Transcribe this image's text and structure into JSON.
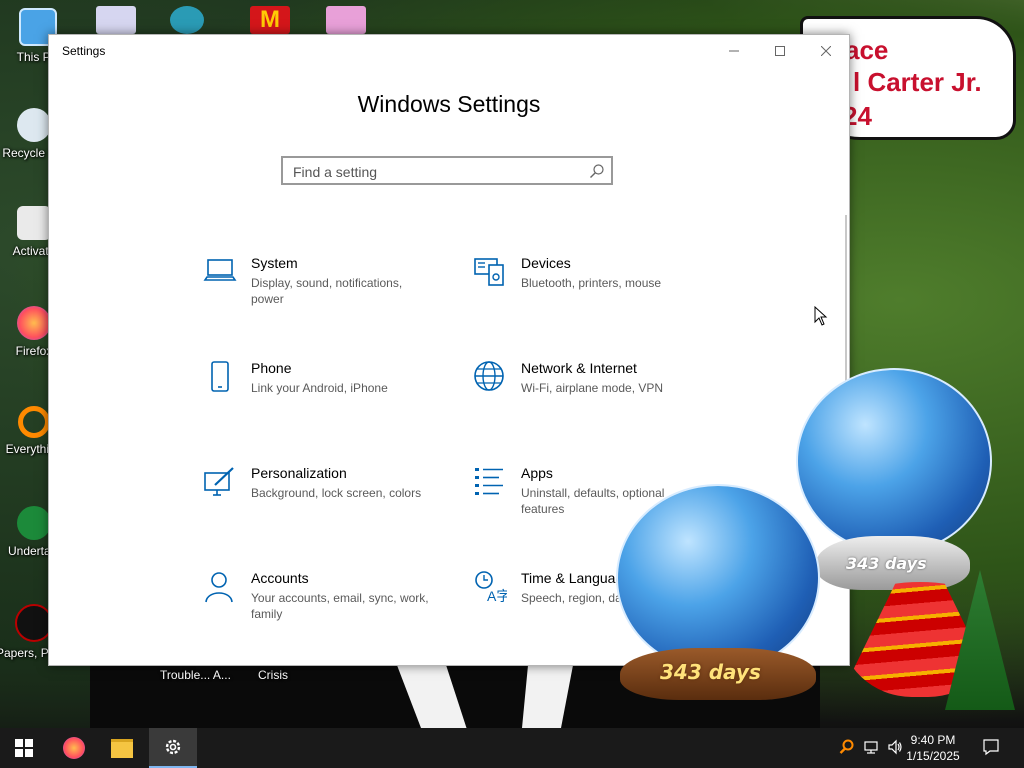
{
  "window": {
    "title": "Settings",
    "heading": "Windows Settings",
    "search_placeholder": "Find a setting"
  },
  "categories": [
    {
      "name": "System",
      "desc": "Display, sound, notifications, power",
      "icon": "laptop-icon"
    },
    {
      "name": "Devices",
      "desc": "Bluetooth, printers, mouse",
      "icon": "devices-icon"
    },
    {
      "name": "Phone",
      "desc": "Link your Android, iPhone",
      "icon": "phone-icon"
    },
    {
      "name": "Network & Internet",
      "desc": "Wi-Fi, airplane mode, VPN",
      "icon": "globe-icon"
    },
    {
      "name": "Personalization",
      "desc": "Background, lock screen, colors",
      "icon": "paint-icon"
    },
    {
      "name": "Apps",
      "desc": "Uninstall, defaults, optional features",
      "icon": "apps-list-icon"
    },
    {
      "name": "Accounts",
      "desc": "Your accounts, email, sync, work, family",
      "icon": "person-icon"
    },
    {
      "name": "Time & Language",
      "desc": "Speech, region, date",
      "icon": "time-language-icon"
    }
  ],
  "desktop": {
    "icons": [
      "This PC",
      "Recycle Bin",
      "Activate",
      "Firefox",
      "Everything",
      "Undertale",
      "Papers, Please"
    ],
    "under_labels": [
      "Trouble... A...",
      "Crisis"
    ],
    "bubble_lines": [
      "ace",
      "l Carter Jr.",
      "24"
    ],
    "globe_label": "343 days"
  },
  "taskbar": {
    "time": "9:40 PM",
    "date": "1/15/2025"
  },
  "colors": {
    "accent": "#0063b1",
    "taskbar": "#1a1a1a"
  }
}
